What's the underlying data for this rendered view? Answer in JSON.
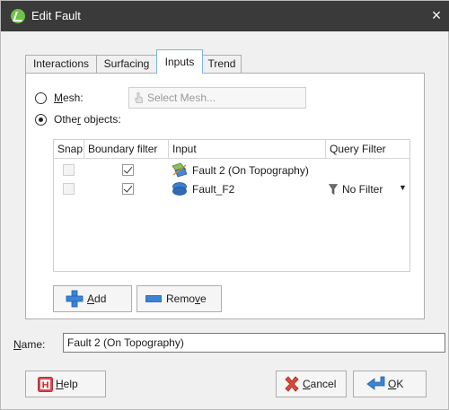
{
  "window": {
    "title": "Edit Fault",
    "close_glyph": "×"
  },
  "tabs": [
    {
      "label": "Interactions",
      "active": false
    },
    {
      "label": "Surfacing",
      "active": false
    },
    {
      "label": "Inputs",
      "active": true
    },
    {
      "label": "Trend",
      "active": false
    }
  ],
  "inputs_panel": {
    "mesh_option": {
      "label": "Mesh:",
      "selected": false
    },
    "select_mesh_button": {
      "label": "Select Mesh...",
      "enabled": false
    },
    "other_objects_option": {
      "label": "Other objects:",
      "selected": true
    },
    "table": {
      "columns": [
        "Snap",
        "Boundary filter",
        "Input",
        "Query Filter"
      ],
      "rows": [
        {
          "snap": false,
          "snap_enabled": false,
          "boundary_filter": true,
          "input": "Fault 2 (On Topography)",
          "input_icon": "fault-surface-icon",
          "query_filter": ""
        },
        {
          "snap": false,
          "snap_enabled": false,
          "boundary_filter": true,
          "input": "Fault_F2",
          "input_icon": "fault-blob-icon",
          "query_filter": "No Filter",
          "query_filter_icon": "funnel-icon"
        }
      ]
    },
    "add_button": {
      "label": "Add"
    },
    "remove_button": {
      "label": "Remove"
    }
  },
  "name_field": {
    "label": "Name:",
    "value": "Fault 2 (On Topography)"
  },
  "footer": {
    "help_label": "Help",
    "cancel_label": "Cancel",
    "ok_label": "OK"
  },
  "colors": {
    "titlebar": "#3a3a3a",
    "app_icon": "#6cc24a",
    "accent_blue": "#2f76c9",
    "cancel_red": "#d9342b"
  }
}
